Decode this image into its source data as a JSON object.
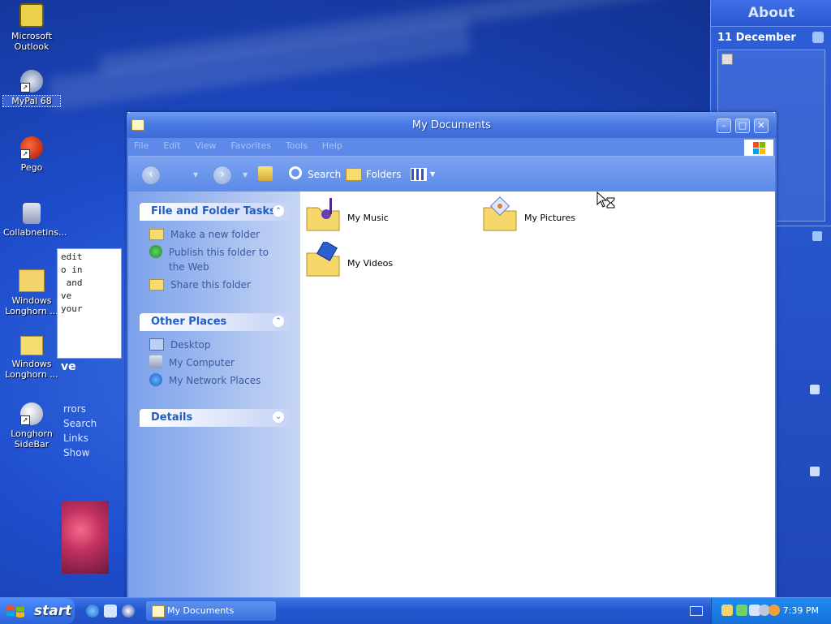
{
  "desktop": {
    "icons": [
      {
        "label": "Microsoft Outlook"
      },
      {
        "label": "MyPal 68"
      },
      {
        "label": "Pego"
      },
      {
        "label": "Collabnetins..."
      },
      {
        "label": "Windows Longhorn ..."
      },
      {
        "label": "Windows Longhorn ..."
      },
      {
        "label": "Longhorn SideBar"
      }
    ]
  },
  "sidebar": {
    "title": "About",
    "date": "11 December",
    "notes_text": "edit\no in\n and\nve\nyour",
    "more_label": "ve",
    "links": [
      "rrors",
      "Search",
      "Links",
      "Show"
    ]
  },
  "window": {
    "title": "My Documents",
    "menu": [
      "File",
      "Edit",
      "View",
      "Favorites",
      "Tools",
      "Help"
    ],
    "toolbar": {
      "search": "Search",
      "folders": "Folders"
    },
    "task_groups": [
      {
        "title": "File and Folder Tasks",
        "items": [
          "Make a new folder",
          "Publish this folder to the Web",
          "Share this folder"
        ]
      },
      {
        "title": "Other Places",
        "items": [
          "Desktop",
          "My Computer",
          "My Network Places"
        ]
      },
      {
        "title": "Details",
        "items": []
      }
    ],
    "folders": [
      {
        "label": "My Music"
      },
      {
        "label": "My Pictures"
      },
      {
        "label": "My Videos"
      }
    ]
  },
  "taskbar": {
    "start_label": "start",
    "active_task": "My Documents",
    "clock": "7:39 PM"
  },
  "colors": {
    "accent": "#215dc6",
    "titlebar": "#4a7ae4",
    "taskbar": "#2458d1"
  }
}
